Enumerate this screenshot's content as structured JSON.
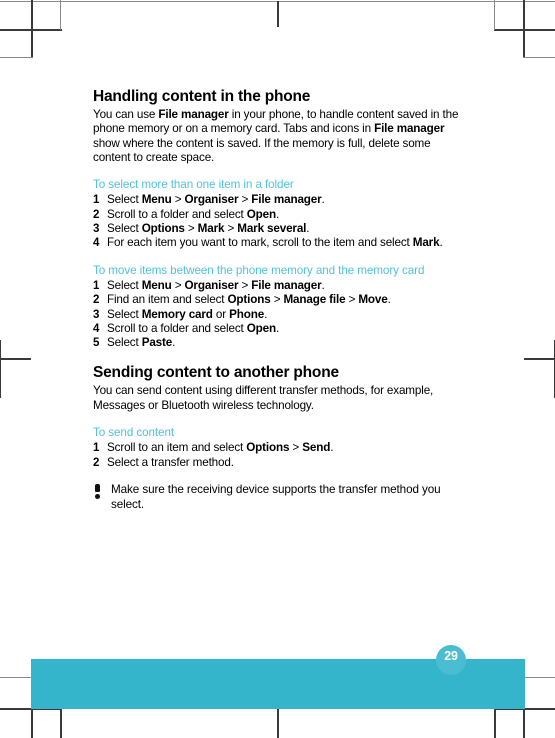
{
  "document": {
    "page_number": "29",
    "colors": {
      "accent_teal": "#35b5cc",
      "tab_teal": "#4bbdd2",
      "procedure_heading": "#4fc3dd",
      "text": "#000000"
    }
  },
  "sections": [
    {
      "title": "Handling content in the phone",
      "intro_parts": [
        {
          "text": "You can use ",
          "bold": false
        },
        {
          "text": "File manager",
          "bold": true
        },
        {
          "text": " in your phone, to handle content saved in the phone memory or on a memory card. Tabs and icons in ",
          "bold": false
        },
        {
          "text": "File manager",
          "bold": true
        },
        {
          "text": " show where the content is saved. If the memory is full, delete some content to create space.",
          "bold": false
        }
      ],
      "intro_plain": "You can use File manager in your phone, to handle content saved in the phone memory or on a memory card. Tabs and icons in File manager show where the content is saved. If the memory is full, delete some content to create space.",
      "procedures": [
        {
          "heading": "To select more than one item in a folder",
          "steps": [
            {
              "num": "1",
              "text": "Select Menu > Organiser > File manager."
            },
            {
              "num": "2",
              "text": "Scroll to a folder and select Open."
            },
            {
              "num": "3",
              "text": "Select Options > Mark > Mark several."
            },
            {
              "num": "4",
              "text": "For each item you want to mark, scroll to the item and select Mark."
            }
          ]
        },
        {
          "heading": "To move items between the phone memory and the memory card",
          "steps": [
            {
              "num": "1",
              "text": "Select Menu > Organiser > File manager."
            },
            {
              "num": "2",
              "text": "Find an item and select Options > Manage file > Move."
            },
            {
              "num": "3",
              "text": "Select Memory card or Phone."
            },
            {
              "num": "4",
              "text": "Scroll to a folder and select Open."
            },
            {
              "num": "5",
              "text": "Select Paste."
            }
          ]
        }
      ]
    },
    {
      "title": "Sending content to another phone",
      "intro_plain": "You can send content using different transfer methods, for example, Messages or Bluetooth wireless technology.",
      "procedures": [
        {
          "heading": "To send content",
          "steps": [
            {
              "num": "1",
              "text": "Scroll to an item and select Options > Send."
            },
            {
              "num": "2",
              "text": "Select a transfer method."
            }
          ]
        }
      ]
    }
  ],
  "note": {
    "icon": "exclamation-icon",
    "text": "Make sure the receiving device supports the transfer method you select."
  }
}
